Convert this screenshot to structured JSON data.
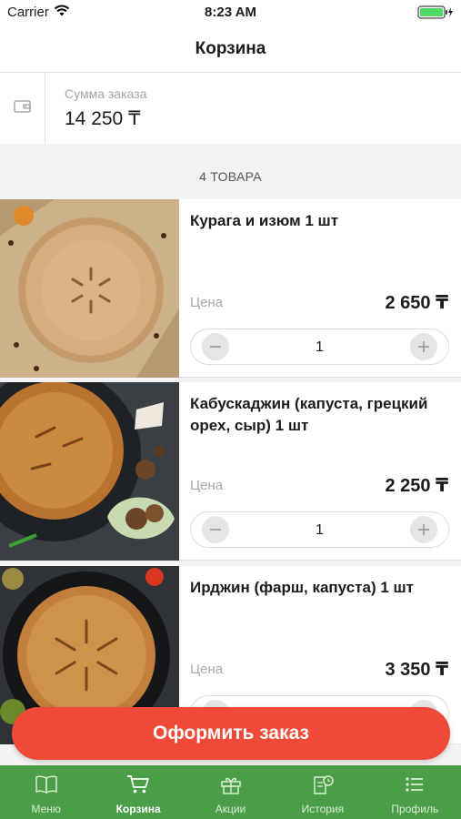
{
  "status_bar": {
    "carrier": "Carrier",
    "time": "8:23 AM"
  },
  "nav": {
    "title": "Корзина"
  },
  "summary": {
    "label": "Сумма заказа",
    "value": "14 250 ₸"
  },
  "items_count": "4 ТОВАРА",
  "products": [
    {
      "name": "Курага и изюм 1 шт",
      "price_label": "Цена",
      "price": "2 650 ₸",
      "quantity": "1"
    },
    {
      "name": "Кабускаджин (капуста, грецкий орех, сыр) 1 шт",
      "price_label": "Цена",
      "price": "2 250 ₸",
      "quantity": "1"
    },
    {
      "name": "Ирджин (фарш, капуста) 1 шт",
      "price_label": "Цена",
      "price": "3 350 ₸"
    }
  ],
  "checkout": {
    "label": "Оформить заказ"
  },
  "tabs": [
    {
      "label": "Меню",
      "icon": "book-icon"
    },
    {
      "label": "Корзина",
      "icon": "cart-icon",
      "active": true
    },
    {
      "label": "Акции",
      "icon": "gift-icon"
    },
    {
      "label": "История",
      "icon": "history-icon"
    },
    {
      "label": "Профиль",
      "icon": "list-icon"
    }
  ],
  "colors": {
    "accent": "#ef4a37",
    "tab_bar": "#4a9e47",
    "background": "#f2f2f2"
  }
}
